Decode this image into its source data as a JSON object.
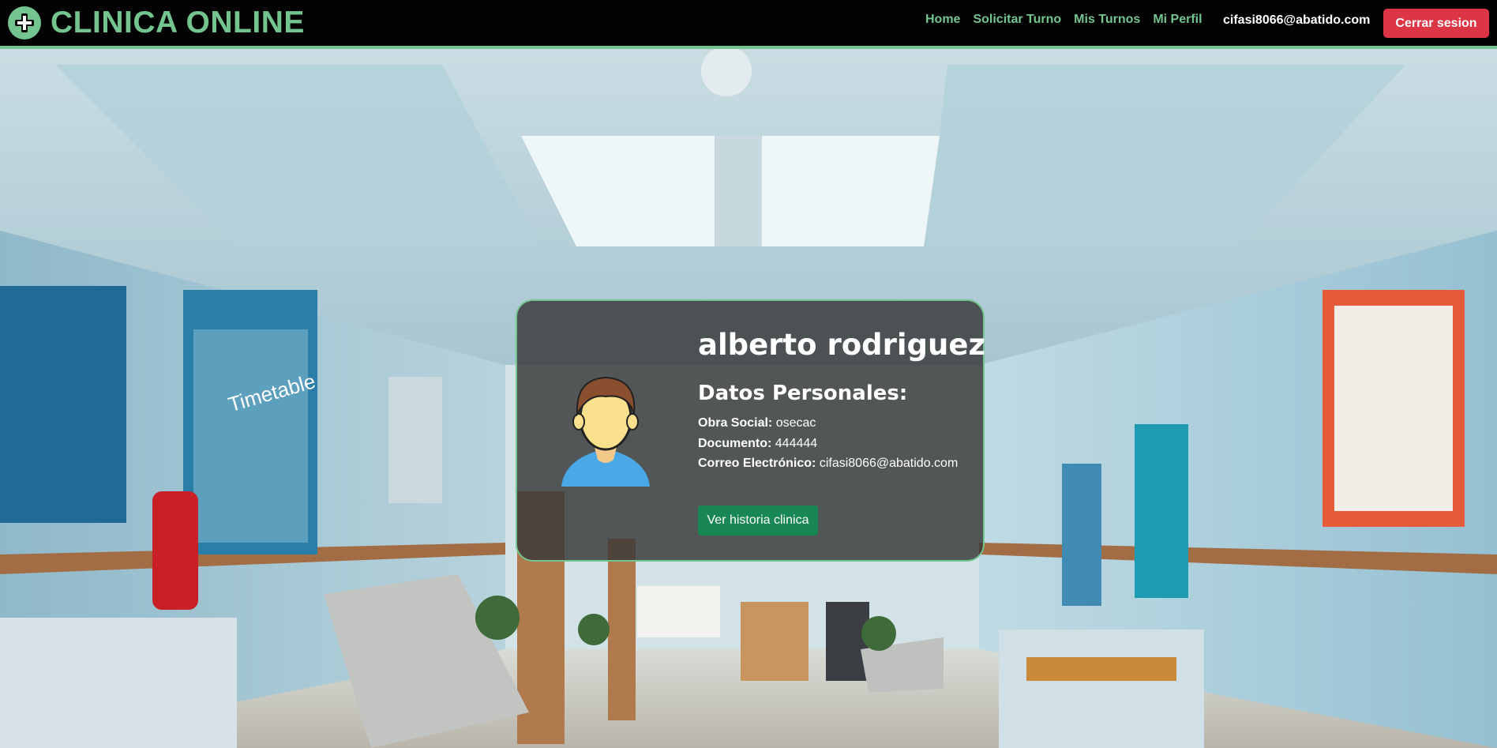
{
  "navbar": {
    "brand_icon": "medical-cross-icon",
    "brand_title": "CLINICA ONLINE",
    "links": [
      {
        "label": "Home"
      },
      {
        "label": "Solicitar Turno"
      },
      {
        "label": "Mis Turnos"
      },
      {
        "label": "Mi Perfil"
      }
    ],
    "user_email": "cifasi8066@abatido.com",
    "logout_label": "Cerrar sesion"
  },
  "profile": {
    "avatar_icon": "user-avatar-icon",
    "name": "alberto rodriguez",
    "section_title": "Datos Personales:",
    "fields": [
      {
        "label": "Obra Social:",
        "value": "osecac"
      },
      {
        "label": "Documento:",
        "value": "444444"
      },
      {
        "label": "Correo Electrónico:",
        "value": "cifasi8066@abatido.com"
      }
    ],
    "history_button_label": "Ver historia clinica"
  },
  "background": {
    "description_icon": "hospital-corridor-image",
    "poster_text": "Timetable"
  },
  "colors": {
    "accent_green": "#73c48f",
    "navbar_bg": "#030303",
    "logout_red": "#dc3545",
    "history_green": "#198754",
    "card_bg": "#373737"
  }
}
